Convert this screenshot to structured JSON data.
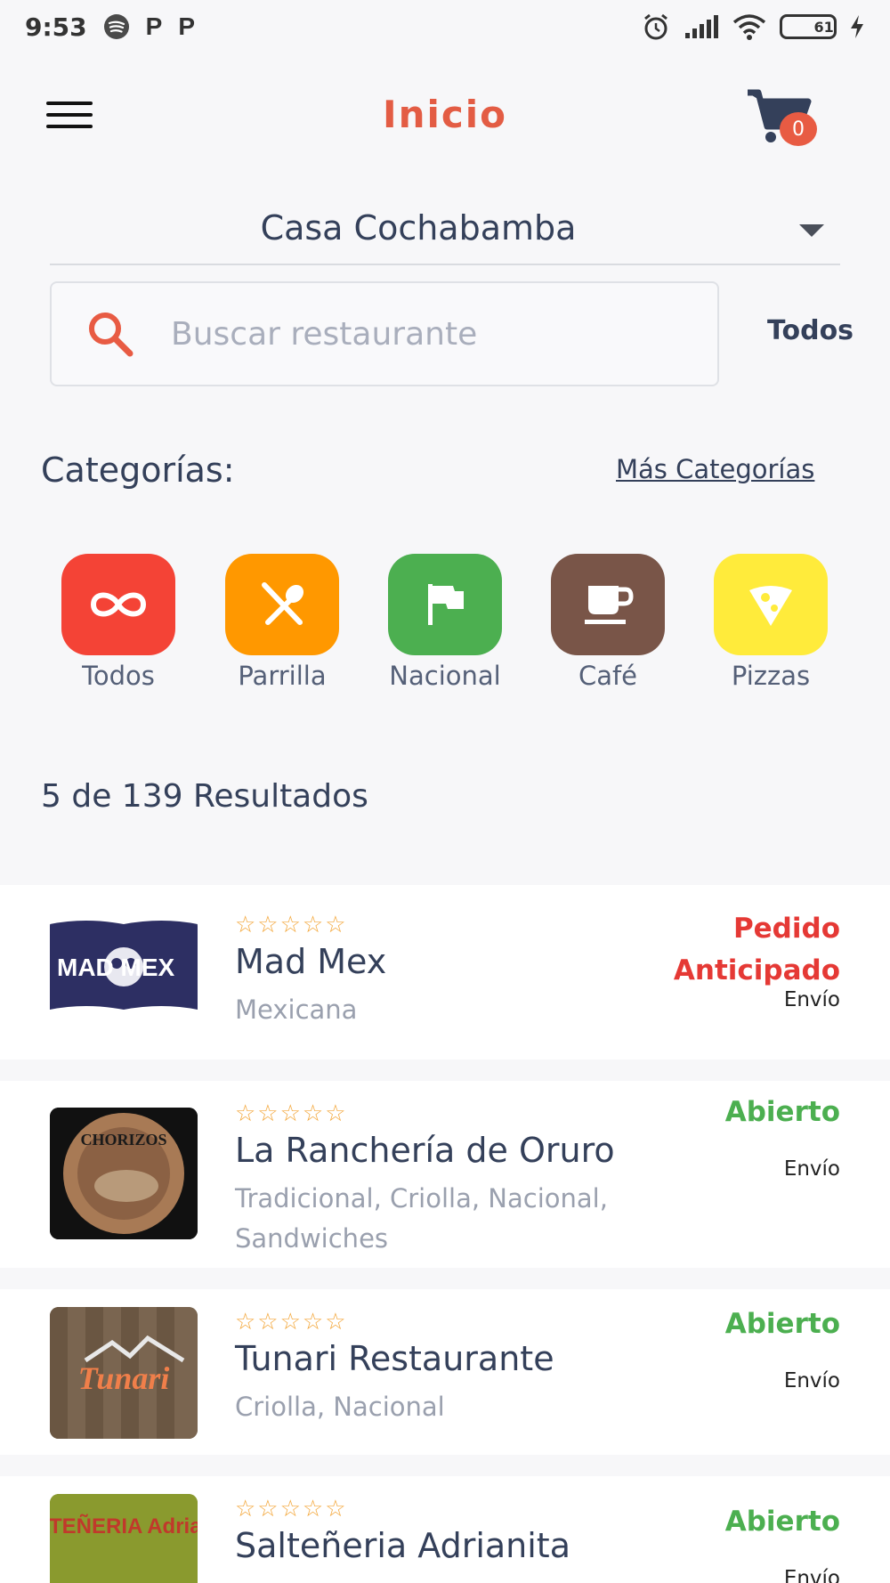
{
  "status_bar": {
    "time": "9:53",
    "p1": "P",
    "p2": "P",
    "battery": "61"
  },
  "header": {
    "title": "Inicio",
    "cart_count": "0"
  },
  "location": {
    "value": "Casa Cochabamba"
  },
  "search": {
    "placeholder": "Buscar restaurante",
    "value": "",
    "filter_label": "Todos"
  },
  "categories": {
    "title": "Categorías:",
    "more_label": "Más Categorías",
    "items": [
      {
        "label": "Todos",
        "icon": "infinity-icon",
        "color": "#f44336"
      },
      {
        "label": "Parrilla",
        "icon": "utensils-icon",
        "color": "#ff9800"
      },
      {
        "label": "Nacional",
        "icon": "flag-icon",
        "color": "#4caf50"
      },
      {
        "label": "Café",
        "icon": "coffee-icon",
        "color": "#795548"
      },
      {
        "label": "Pizzas",
        "icon": "pizza-icon",
        "color": "#ffeb3b"
      }
    ]
  },
  "results_label": "5 de 139 Resultados",
  "restaurants": [
    {
      "stars": "☆☆☆☆☆",
      "name": "Mad Mex",
      "tags": "Mexicana",
      "status": "Pedido Anticipado",
      "status_color": "#e53935",
      "delivery": "Envío",
      "logo_text": "MAD MEX"
    },
    {
      "stars": "☆☆☆☆☆",
      "name": "La Ranchería de Oruro",
      "tags": "Tradicional, Criolla, Nacional, Sandwiches",
      "status": "Abierto",
      "status_color": "#4caf50",
      "delivery": "Envío",
      "logo_text": "CHORIZOS"
    },
    {
      "stars": "☆☆☆☆☆",
      "name": "Tunari Restaurante",
      "tags": "Criolla, Nacional",
      "status": "Abierto",
      "status_color": "#4caf50",
      "delivery": "Envío",
      "logo_text": "Tunari"
    },
    {
      "stars": "☆☆☆☆☆",
      "name": "Salteñeria Adrianita",
      "tags": "",
      "status": "Abierto",
      "status_color": "#4caf50",
      "delivery": "Envío",
      "logo_text": "SALTEÑERIA Adrianita"
    }
  ]
}
